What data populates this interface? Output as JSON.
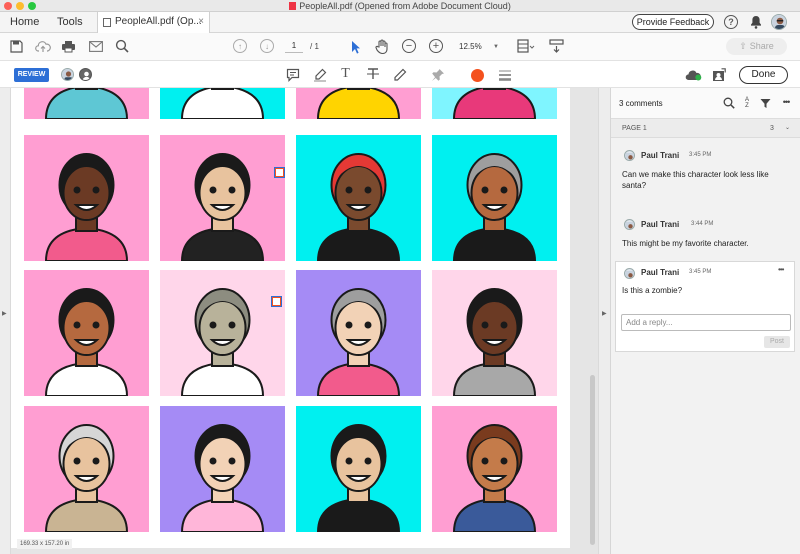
{
  "window": {
    "title": "PeopleAll.pdf (Opened from Adobe Document Cloud)"
  },
  "tabs": {
    "home": "Home",
    "tools": "Tools",
    "document": "PeopleAll.pdf (Op..."
  },
  "header": {
    "feedback": "Provide Feedback"
  },
  "toolbar": {
    "page_current": "1",
    "page_total": "/ 1",
    "zoom": "12.5%",
    "share": "Share"
  },
  "review": {
    "badge": "REVIEW",
    "done": "Done",
    "color_accent": "#f4511e"
  },
  "status": {
    "page_size": "169.33 x 157.20 in"
  },
  "comments_panel": {
    "count_label": "3 comments",
    "page_label": "PAGE 1",
    "page_count": "3",
    "items": [
      {
        "author": "Paul Trani",
        "time": "3:45 PM",
        "text": "Can we make this character look less like santa?"
      },
      {
        "author": "Paul Trani",
        "time": "3:44 PM",
        "text": "This might be my favorite character."
      },
      {
        "author": "Paul Trani",
        "time": "3:45 PM",
        "text": "Is this a zombie?"
      }
    ],
    "reply_placeholder": "Add a reply...",
    "post": "Post"
  },
  "tiles": [
    {
      "bg": "#ff9ed2",
      "skin": "#c47b4a",
      "hair": "#1a1a1a",
      "shirt": "#5ec7d4"
    },
    {
      "bg": "#00f0f0",
      "skin": "#e8c39e",
      "hair": "#1a1a1a",
      "shirt": "#ffffff"
    },
    {
      "bg": "#ff9ed2",
      "skin": "#e8c39e",
      "hair": "#1a1a1a",
      "shirt": "#ffd400"
    },
    {
      "bg": "#7ff5ff",
      "skin": "#c47b4a",
      "hair": "#1a1a1a",
      "shirt": "#e8397a"
    },
    {
      "bg": "#ff9ed2",
      "skin": "#6b3a24",
      "hair": "#1a1a1a",
      "shirt": "#f25b8c"
    },
    {
      "bg": "#ff9ed2",
      "skin": "#e8c39e",
      "hair": "#1a1a1a",
      "shirt": "#222222"
    },
    {
      "bg": "#00f0f0",
      "skin": "#7a4a2e",
      "hair": "#e53935",
      "shirt": "#1a1a1a"
    },
    {
      "bg": "#00f0f0",
      "skin": "#b5693f",
      "hair": "#9e9e9e",
      "shirt": "#1a1a1a"
    },
    {
      "bg": "#ff9ed2",
      "skin": "#b5693f",
      "hair": "#1a1a1a",
      "shirt": "#ffffff"
    },
    {
      "bg": "#ffd6ea",
      "skin": "#b8b29a",
      "hair": "#8d8d80",
      "shirt": "#ffffff"
    },
    {
      "bg": "#a58bf5",
      "skin": "#f2d2b6",
      "hair": "#9e9e9e",
      "shirt": "#f25b8c"
    },
    {
      "bg": "#ffd6ea",
      "skin": "#6b3a24",
      "hair": "#1a1a1a",
      "shirt": "#a8a8a8"
    },
    {
      "bg": "#ff9ed2",
      "skin": "#e8c39e",
      "hair": "#d6d6d6",
      "shirt": "#c9b493"
    },
    {
      "bg": "#a58bf5",
      "skin": "#f2d2b6",
      "hair": "#1a1a1a",
      "shirt": "#ffb6d9"
    },
    {
      "bg": "#00f0f0",
      "skin": "#e8c39e",
      "hair": "#1a1a1a",
      "shirt": "#1a1a1a"
    },
    {
      "bg": "#ff9ed2",
      "skin": "#c47b4a",
      "hair": "#7a3b1e",
      "shirt": "#3a5a9a"
    }
  ]
}
